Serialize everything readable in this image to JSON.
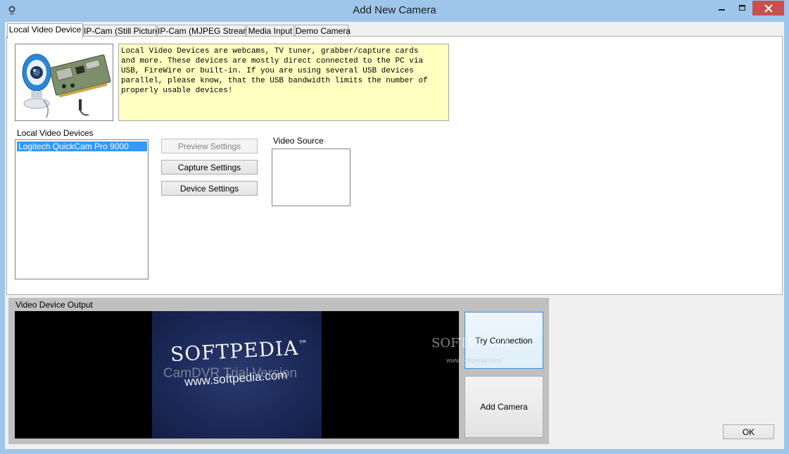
{
  "window": {
    "title": "Add New Camera"
  },
  "tabs": [
    {
      "label": "Local Video Device",
      "active": true
    },
    {
      "label": "IP-Cam (Still Picture)",
      "active": false
    },
    {
      "label": "IP-Cam (MJPEG Stream)",
      "active": false
    },
    {
      "label": "Media Input",
      "active": false
    },
    {
      "label": "Demo Camera",
      "active": false
    }
  ],
  "info_text": "Local Video Devices are webcams, TV tuner, grabber/capture cards\nand more. These devices are mostly direct connected to the PC via\nUSB, FireWire or built-in. If you are using several USB devices\nparallel, please know, that the USB bandwidth limits the number of\nproperly usable devices!",
  "devices": {
    "label": "Local Video Devices",
    "items": [
      "Logitech QuickCam Pro 9000"
    ],
    "selected_index": 0
  },
  "settings_buttons": {
    "preview": "Preview Settings",
    "capture": "Capture Settings",
    "device": "Device Settings"
  },
  "video_source": {
    "label": "Video Source"
  },
  "output": {
    "label": "Video Device Output",
    "preview_brand": "SOFTPEDIA",
    "preview_trademark": "™",
    "preview_url": "www.softpedia.com",
    "preview_overlay": "CamDVR Trial Version"
  },
  "actions": {
    "try_connection": "Try Connection",
    "add_camera": "Add Camera",
    "ok": "OK"
  },
  "watermark": {
    "brand": "SOFTPEDIA",
    "url": "www.softpedia.com"
  },
  "colors": {
    "title_bar": "#9dc6ea",
    "selection": "#3399ff",
    "info_background": "#ffffc0",
    "close_button": "#c7504c"
  }
}
